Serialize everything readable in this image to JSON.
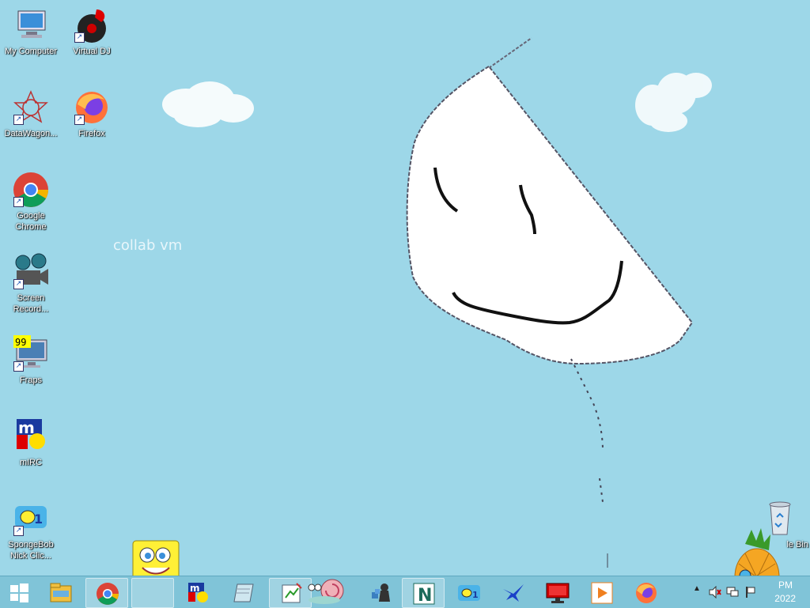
{
  "desktop": {
    "watermark": "collab vm",
    "icons": [
      {
        "label": "My Computer"
      },
      {
        "label": "Virtual DJ"
      },
      {
        "label": "DataWagon..."
      },
      {
        "label": "Firefox"
      },
      {
        "label": "Google Chrome"
      },
      {
        "label": "Screen Record..."
      },
      {
        "label": "Fraps"
      },
      {
        "label": "mIRC"
      },
      {
        "label": "SpongeBob Nick Clic..."
      },
      {
        "label": "Recycle Bin",
        "visible_text": "le Bin"
      }
    ]
  },
  "taskbar": {
    "items": [
      {
        "name": "start-button",
        "icon": "windows-logo-icon"
      },
      {
        "name": "file-explorer",
        "icon": "folder-icon"
      },
      {
        "name": "chrome",
        "icon": "chrome-icon"
      },
      {
        "name": "spongebob-app",
        "icon": "spongebob-icon"
      },
      {
        "name": "mirc",
        "icon": "mirc-icon"
      },
      {
        "name": "notepad",
        "icon": "notepad-icon"
      },
      {
        "name": "paint-app",
        "icon": "paint-icon"
      },
      {
        "name": "gary-snail",
        "icon": "snail-icon"
      },
      {
        "name": "chess",
        "icon": "chess-icon"
      },
      {
        "name": "notepad-plus",
        "icon": "n-app-icon"
      },
      {
        "name": "nick-clicks",
        "icon": "nick-icon"
      },
      {
        "name": "bird-app",
        "icon": "bird-icon"
      },
      {
        "name": "monitor-app",
        "icon": "monitor-icon"
      },
      {
        "name": "media-player",
        "icon": "media-player-icon"
      },
      {
        "name": "firefox",
        "icon": "firefox-icon"
      }
    ],
    "tray": {
      "chevron": "▲",
      "time": "PM",
      "date": "2022"
    }
  },
  "colors": {
    "desktop_bg": "#9dd7e8",
    "taskbar_bg": "#80c4d8"
  }
}
